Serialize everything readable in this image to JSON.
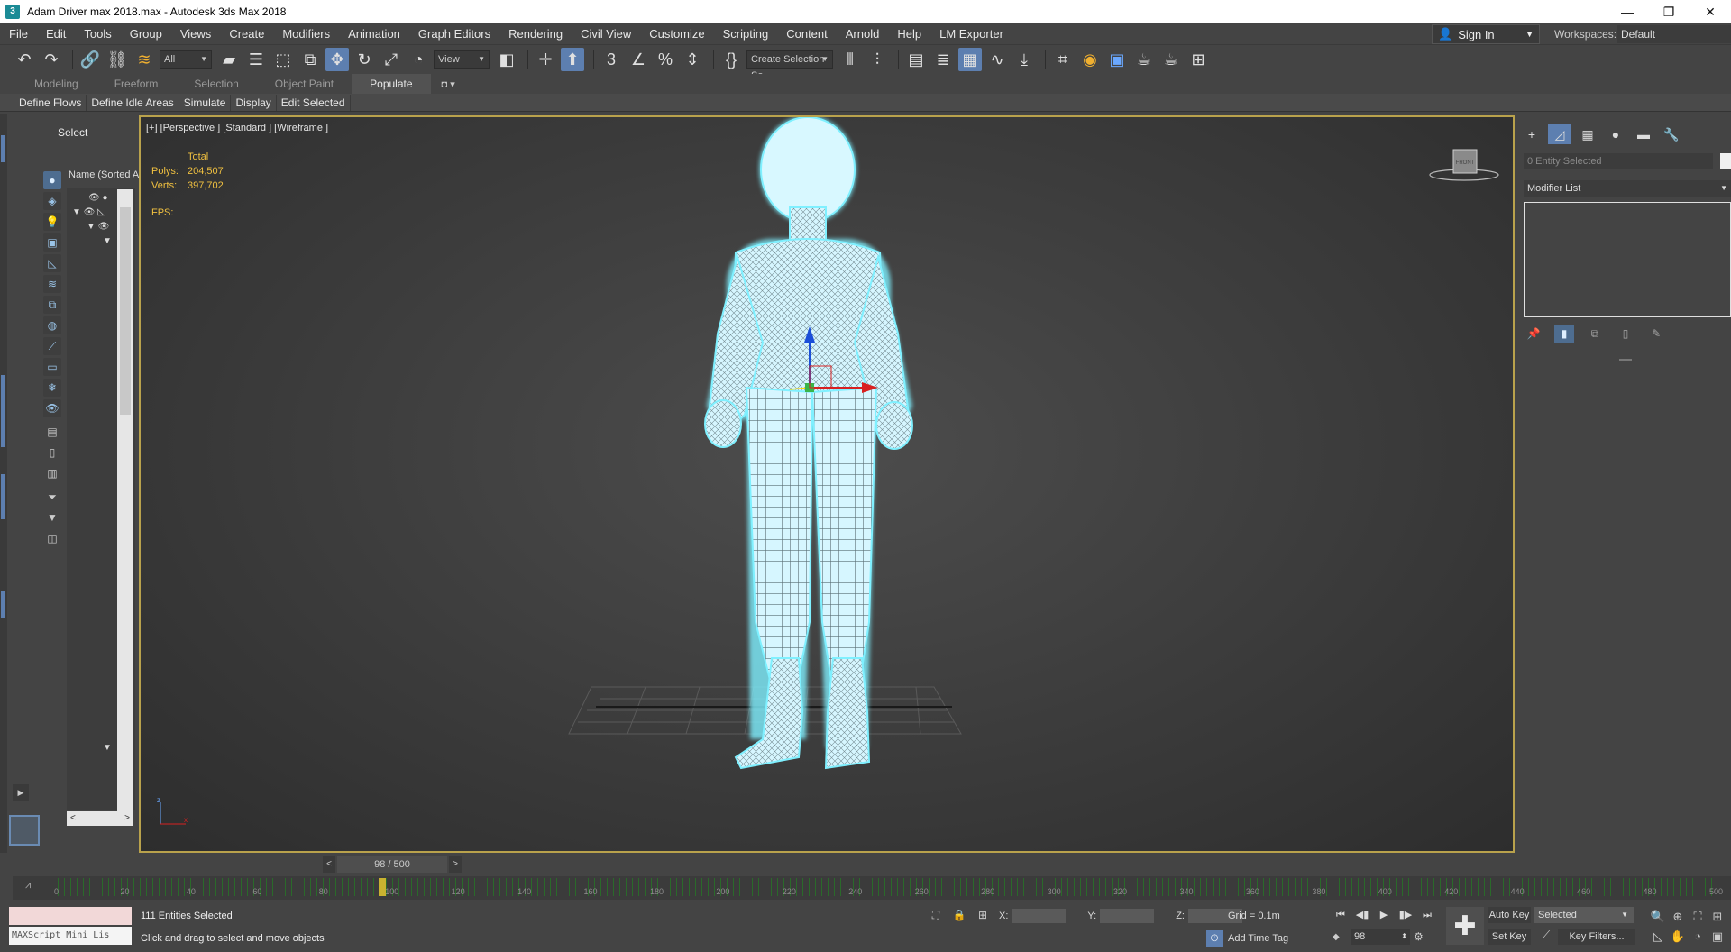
{
  "window": {
    "title": "Adam Driver max 2018.max - Autodesk 3ds Max 2018",
    "minimize": "—",
    "restore": "❐",
    "close": "✕"
  },
  "menu": {
    "items": [
      "File",
      "Edit",
      "Tools",
      "Group",
      "Views",
      "Create",
      "Modifiers",
      "Animation",
      "Graph Editors",
      "Rendering",
      "Civil View",
      "Customize",
      "Scripting",
      "Content",
      "Arnold",
      "Help",
      "LM Exporter"
    ],
    "sign_in": "Sign In",
    "workspaces_label": "Workspaces:",
    "workspaces_value": "Default"
  },
  "toolbar": {
    "selection_filter": "All",
    "ref_coord": "View",
    "named_selection": "Create Selection Se",
    "snap_label": "3",
    "icons": [
      "undo-icon",
      "redo-icon",
      "link-icon",
      "unlink-icon",
      "bind-spacewarp-icon",
      "select-object-icon",
      "select-by-name-icon",
      "rect-select-icon",
      "window-crossing-icon",
      "move-icon",
      "rotate-icon",
      "scale-icon",
      "place-icon"
    ]
  },
  "ribbon": {
    "tabs": [
      "Modeling",
      "Freeform",
      "Selection",
      "Object Paint",
      "Populate"
    ],
    "active_tab": "Populate",
    "buttons": [
      "Define Flows",
      "Define Idle Areas",
      "Simulate",
      "Display",
      "Edit Selected"
    ]
  },
  "explorer": {
    "header": "Select",
    "column": "Name (Sorted A",
    "scroll_left": "<",
    "scroll_right": ">"
  },
  "viewport": {
    "label": "[+] [Perspective ] [Standard ] [Wireframe ]",
    "stats_header": "Total",
    "polys_label": "Polys:",
    "polys_value": "204,507",
    "verts_label": "Verts:",
    "verts_value": "397,702",
    "fps_label": "FPS:",
    "viewcube_face": "FRONT"
  },
  "command_panel": {
    "name_field": "0 Entity Selected",
    "modifier_list": "Modifier List"
  },
  "time": {
    "slider_value": "98 / 500",
    "current_frame": 98,
    "total_frames": 500,
    "prev": "<",
    "next": ">",
    "track_labels": [
      "0",
      "20",
      "40",
      "60",
      "80",
      "100",
      "120",
      "140",
      "160",
      "180",
      "200",
      "220",
      "240",
      "260",
      "280",
      "300",
      "320",
      "340",
      "360",
      "380",
      "400",
      "420",
      "440",
      "460",
      "480",
      "500"
    ]
  },
  "status": {
    "maxscript_placeholder": "MAXScript Mini Lis",
    "selection": "111 Entities Selected",
    "prompt": "Click and drag to select and move objects",
    "x_label": "X:",
    "y_label": "Y:",
    "z_label": "Z:",
    "grid": "Grid = 0.1m",
    "add_time_tag": "Add Time Tag",
    "frame_value": "98",
    "auto_key": "Auto Key",
    "set_key": "Set Key",
    "selected_dd": "Selected",
    "key_filters": "Key Filters..."
  },
  "colors": {
    "viewport_border": "#b9a24c",
    "wireframe": "#c8f2ff",
    "highlight": "#5d7fb0",
    "stats": "#f0c040"
  }
}
